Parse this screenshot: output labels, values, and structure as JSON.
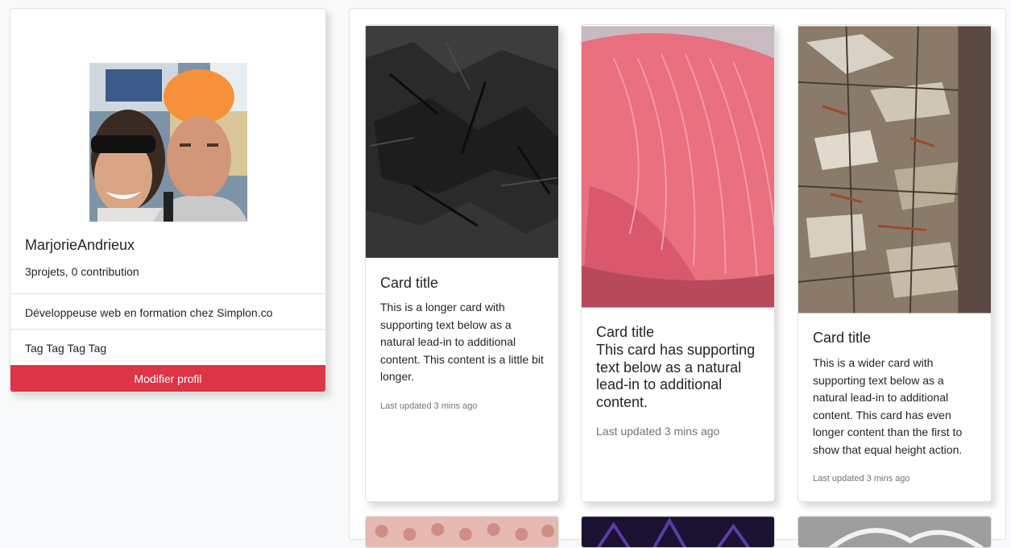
{
  "profile": {
    "name": "MarjorieAndrieux",
    "stats": "3projets, 0 contribution",
    "bio": "Développeuse web en formation chez Simplon.co",
    "tags": "Tag Tag Tag Tag",
    "button_label": "Modifier profil"
  },
  "cards": [
    {
      "title": "Card title",
      "text": "This is a longer card with supporting text below as a natural lead-in to additional content. This content is a little bit longer.",
      "updated": "Last updated 3 mins ago"
    },
    {
      "title": "Card title",
      "text": "This card has supporting text below as a natural lead-in to additional content.",
      "updated": "Last updated 3 mins ago"
    },
    {
      "title": "Card title",
      "text": "This is a wider card with supporting text below as a natural lead-in to additional content. This card has even longer content than the first to show that equal height action.",
      "updated": "Last updated 3 mins ago"
    }
  ],
  "colors": {
    "accent": "#dc3545",
    "background": "#f8f9fa",
    "muted": "#6c757d"
  }
}
